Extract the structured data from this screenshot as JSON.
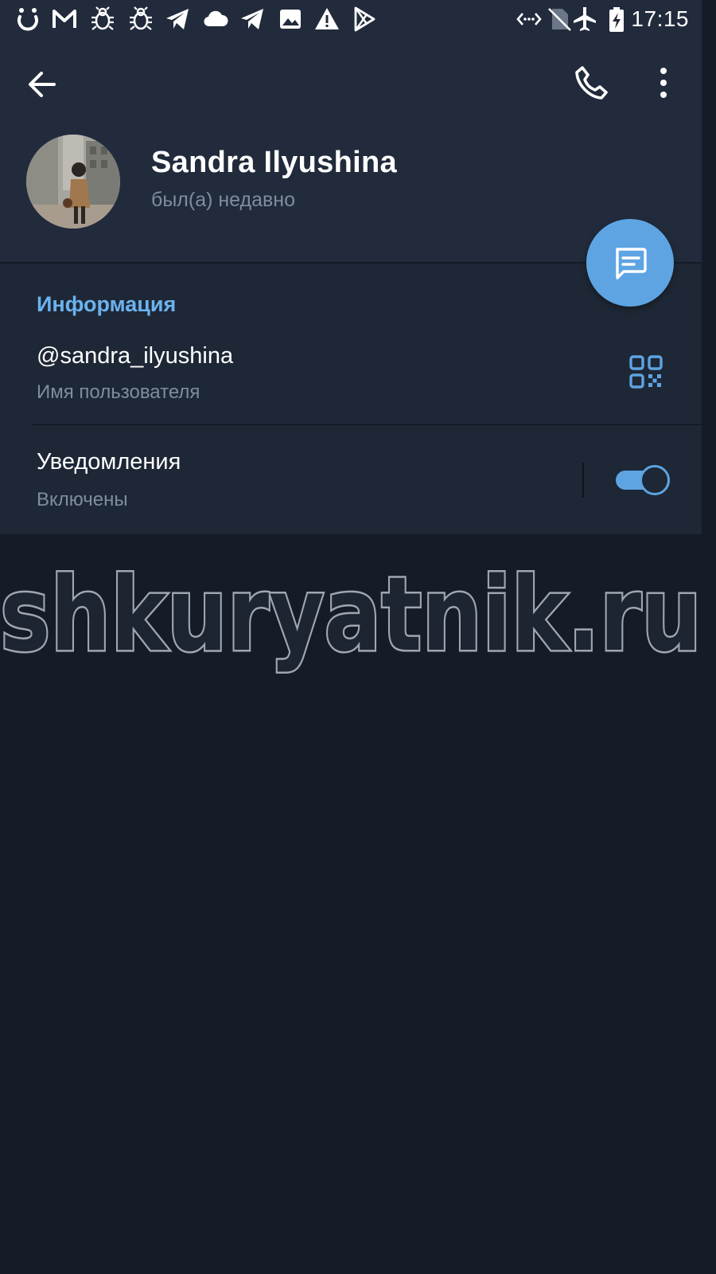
{
  "status_bar": {
    "time": "17:15",
    "left_icons": [
      "spinner-icon",
      "gmail-icon",
      "bug-icon",
      "bug-icon",
      "telegram-icon",
      "cloud-icon",
      "telegram-icon",
      "image-icon",
      "warning-icon",
      "play-store-icon"
    ],
    "right_icons": [
      "data-saver-icon",
      "no-sim-icon",
      "airplane-icon",
      "battery-charging-icon"
    ]
  },
  "toolbar": {
    "back_icon": "arrow-left-icon",
    "call_icon": "phone-icon",
    "menu_icon": "more-vertical-icon"
  },
  "profile": {
    "name": "Sandra Ilyushina",
    "status": "был(а) недавно"
  },
  "fab": {
    "icon": "message-icon"
  },
  "info": {
    "section_title": "Информация",
    "username": "@sandra_ilyushina",
    "username_caption": "Имя пользователя",
    "qr_icon": "qr-code-icon",
    "notifications_title": "Уведомления",
    "notifications_status": "Включены",
    "notifications_enabled": true
  },
  "watermark": {
    "text": "shkuryatnik.ru"
  },
  "colors": {
    "header_bg": "#212b3b",
    "section_bg": "#1e2735",
    "page_bg": "#161c27",
    "accent": "#5ea4e2",
    "section_title": "#6bb3ef",
    "secondary_text": "#7e8d9f"
  }
}
